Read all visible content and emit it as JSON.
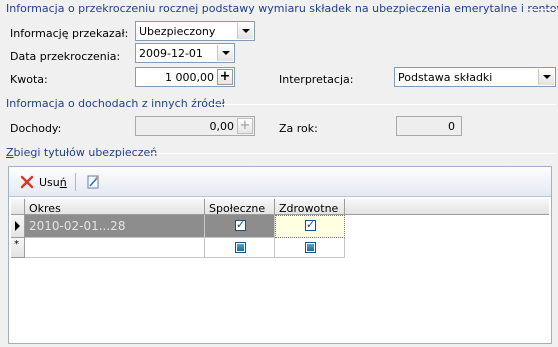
{
  "section1": {
    "title": "Informacja o przekroczeniu rocznej podstawy wymiaru składek na ubezpieczenia emerytalne i rentowe",
    "informacja_label": "Informację przekazał:",
    "informacja_value": "Ubezpieczony",
    "data_label": "Data przekroczenia:",
    "data_value": "2009-12-01",
    "kwota_label": "Kwota:",
    "kwota_value": "1 000,00",
    "interpretacja_label": "Interpretacja:",
    "interpretacja_value": "Podstawa składki"
  },
  "section2": {
    "title": "Informacja o dochodach z innych źródeł",
    "dochody_label": "Dochody:",
    "dochody_value": "0,00",
    "zarok_label": "Za rok:",
    "zarok_value": "0"
  },
  "section3": {
    "title": "Zbiegi tytułów ubezpieczeń",
    "title_underlined": "Z",
    "title_rest": "biegi tytułów ubezpieczeń",
    "toolbar": {
      "usun_pre": "Usu",
      "usun_u": "ń",
      "delete_icon": "red-x-icon",
      "edit_icon": "edit-document-icon"
    },
    "grid": {
      "columns": [
        "Okres",
        "Społeczne",
        "Zdrowotne"
      ],
      "rows": [
        {
          "okres": "2010-02-01...28",
          "spoleczne": true,
          "zdrowotne": true,
          "current": true
        },
        {
          "okres": "",
          "spoleczne": null,
          "zdrowotne": null,
          "new": true
        }
      ]
    }
  },
  "colors": {
    "section_title": "#1f3f8f",
    "selected_row": "#8d8d8d",
    "focused_cell": "#ffffe1"
  }
}
